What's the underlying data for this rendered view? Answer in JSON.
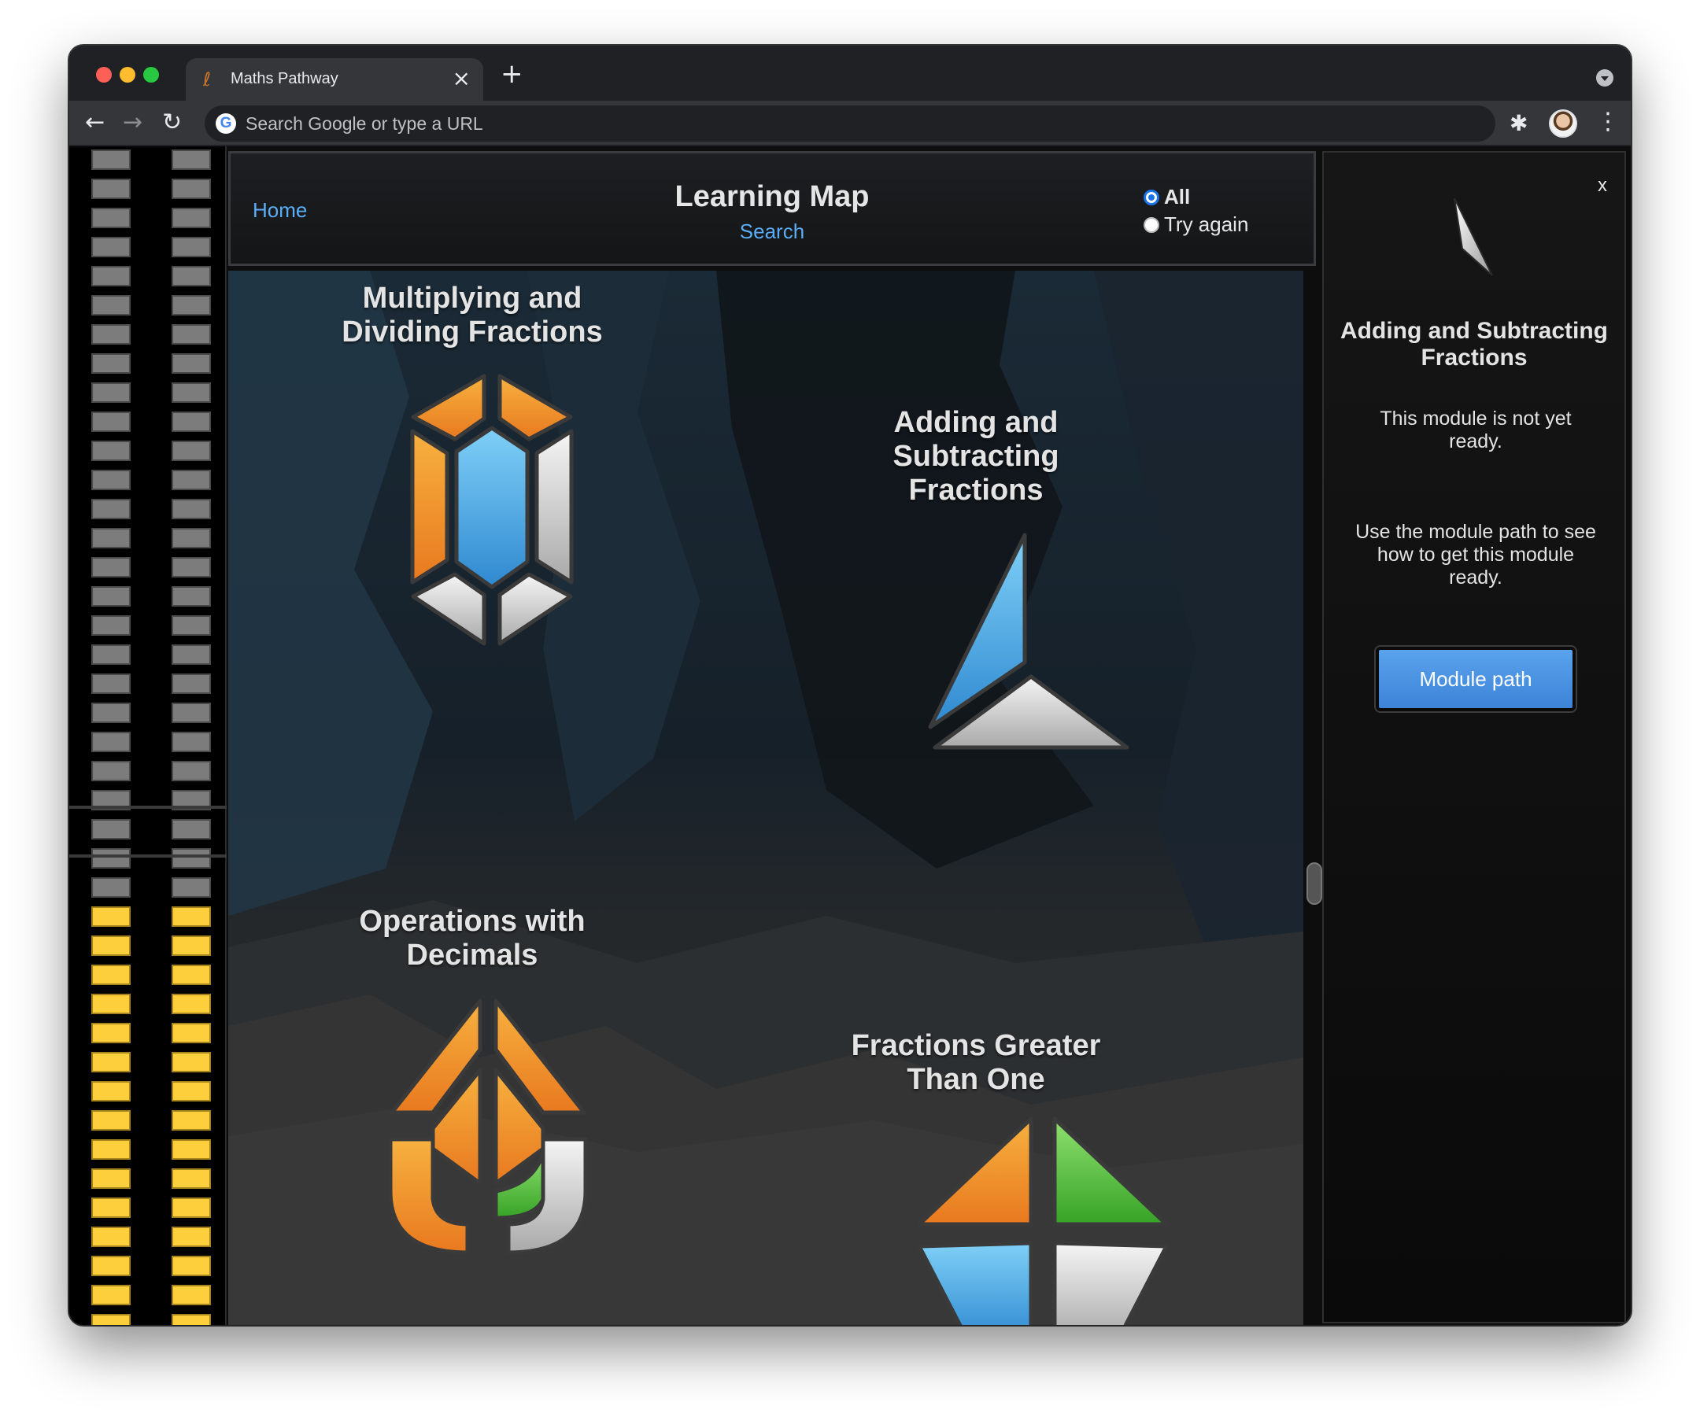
{
  "browser": {
    "tab_title": "Maths Pathway",
    "new_tab_symbol": "+",
    "close_symbol": "×",
    "omnibox_placeholder": "Search Google or type a URL",
    "google_letter": "G"
  },
  "header": {
    "home_label": "Home",
    "title": "Learning Map",
    "search_label": "Search",
    "filters": [
      {
        "label": "All",
        "selected": true
      },
      {
        "label": "Try again",
        "selected": false
      }
    ]
  },
  "progress": {
    "column1_blocks": 41,
    "column2_blocks": 41,
    "completed_fraction": 0.37
  },
  "modules": [
    {
      "title": "Multiplying and Dividing Fractions",
      "icon": "hexagon-gem-icon"
    },
    {
      "title": "Adding and Subtracting Fractions",
      "icon": "triangle-shard-icon"
    },
    {
      "title": "Operations with Decimals",
      "icon": "arrow-leaf-icon"
    },
    {
      "title": "Fractions Greater Than One",
      "icon": "four-part-kite-icon"
    }
  ],
  "panel": {
    "close_label": "x",
    "title": "Adding and Subtracting Fractions",
    "message_1": "This module is not yet ready.",
    "message_2": "Use the module path to see how to get this module ready.",
    "button_label": "Module path"
  },
  "colors": {
    "link": "#5aaef8",
    "orange": "#f0952c",
    "blue": "#5bb6ec",
    "green": "#4cb535",
    "silver": "#d8d8d8",
    "progress_done": "#fdcf3c",
    "progress_todo": "#7c7c7c"
  }
}
